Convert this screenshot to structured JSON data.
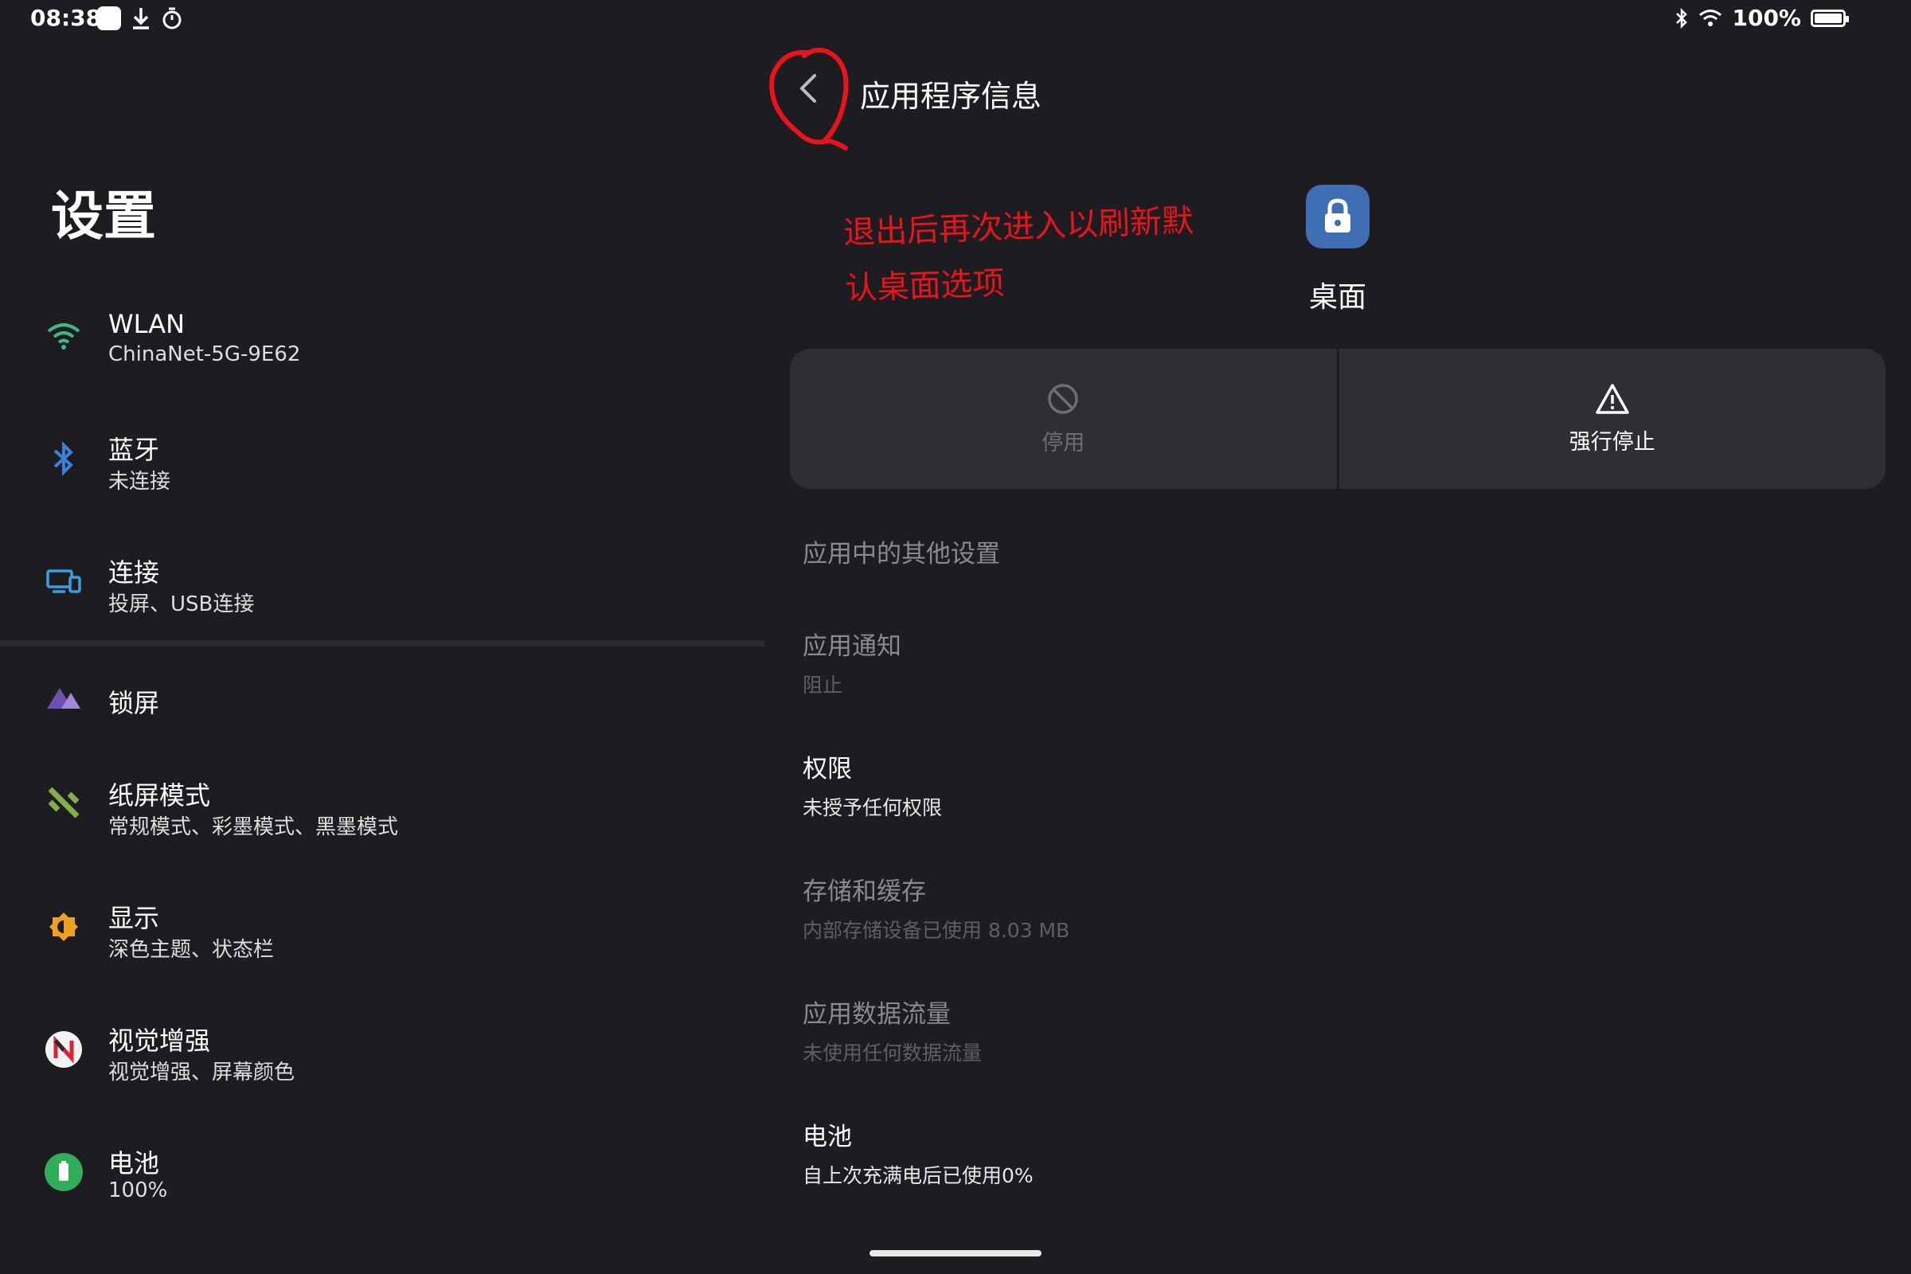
{
  "status_bar": {
    "time": "08:38",
    "battery_text": "100%"
  },
  "settings": {
    "title": "设置",
    "items": [
      {
        "label": "WLAN",
        "sub": "ChinaNet-5G-9E62",
        "icon": "wifi-icon"
      },
      {
        "label": "蓝牙",
        "sub": "未连接",
        "icon": "bluetooth-icon"
      },
      {
        "label": "连接",
        "sub": "投屏、USB连接",
        "icon": "devices-icon"
      },
      {
        "label": "锁屏",
        "sub": "",
        "icon": "lockscreen-icon"
      },
      {
        "label": "纸屏模式",
        "sub": "常规模式、彩墨模式、黑墨模式",
        "icon": "paper-mode-icon"
      },
      {
        "label": "显示",
        "sub": "深色主题、状态栏",
        "icon": "display-icon"
      },
      {
        "label": "视觉增强",
        "sub": "视觉增强、屏幕颜色",
        "icon": "visual-enhance-icon"
      },
      {
        "label": "电池",
        "sub": "100%",
        "icon": "battery-icon"
      }
    ]
  },
  "app_info": {
    "title": "应用程序信息",
    "annotation_line1": "退出后再次进入以刷新默",
    "annotation_line2": "认桌面选项",
    "app_name": "桌面",
    "actions": {
      "disable": "停用",
      "force_stop": "强行停止"
    },
    "rows": {
      "other_settings": {
        "title": "应用中的其他设置"
      },
      "notifications": {
        "title": "应用通知",
        "sub": "阻止"
      },
      "permissions": {
        "title": "权限",
        "sub": "未授予任何权限"
      },
      "storage": {
        "title": "存储和缓存",
        "sub": "内部存储设备已使用 8.03 MB"
      },
      "data_usage": {
        "title": "应用数据流量",
        "sub": "未使用任何数据流量"
      },
      "battery": {
        "title": "电池",
        "sub": "自上次充满电后已使用0%"
      }
    }
  },
  "colors": {
    "background": "#1c1c21",
    "annotation": "#e8141c",
    "app_icon": "#3f6eb5"
  }
}
